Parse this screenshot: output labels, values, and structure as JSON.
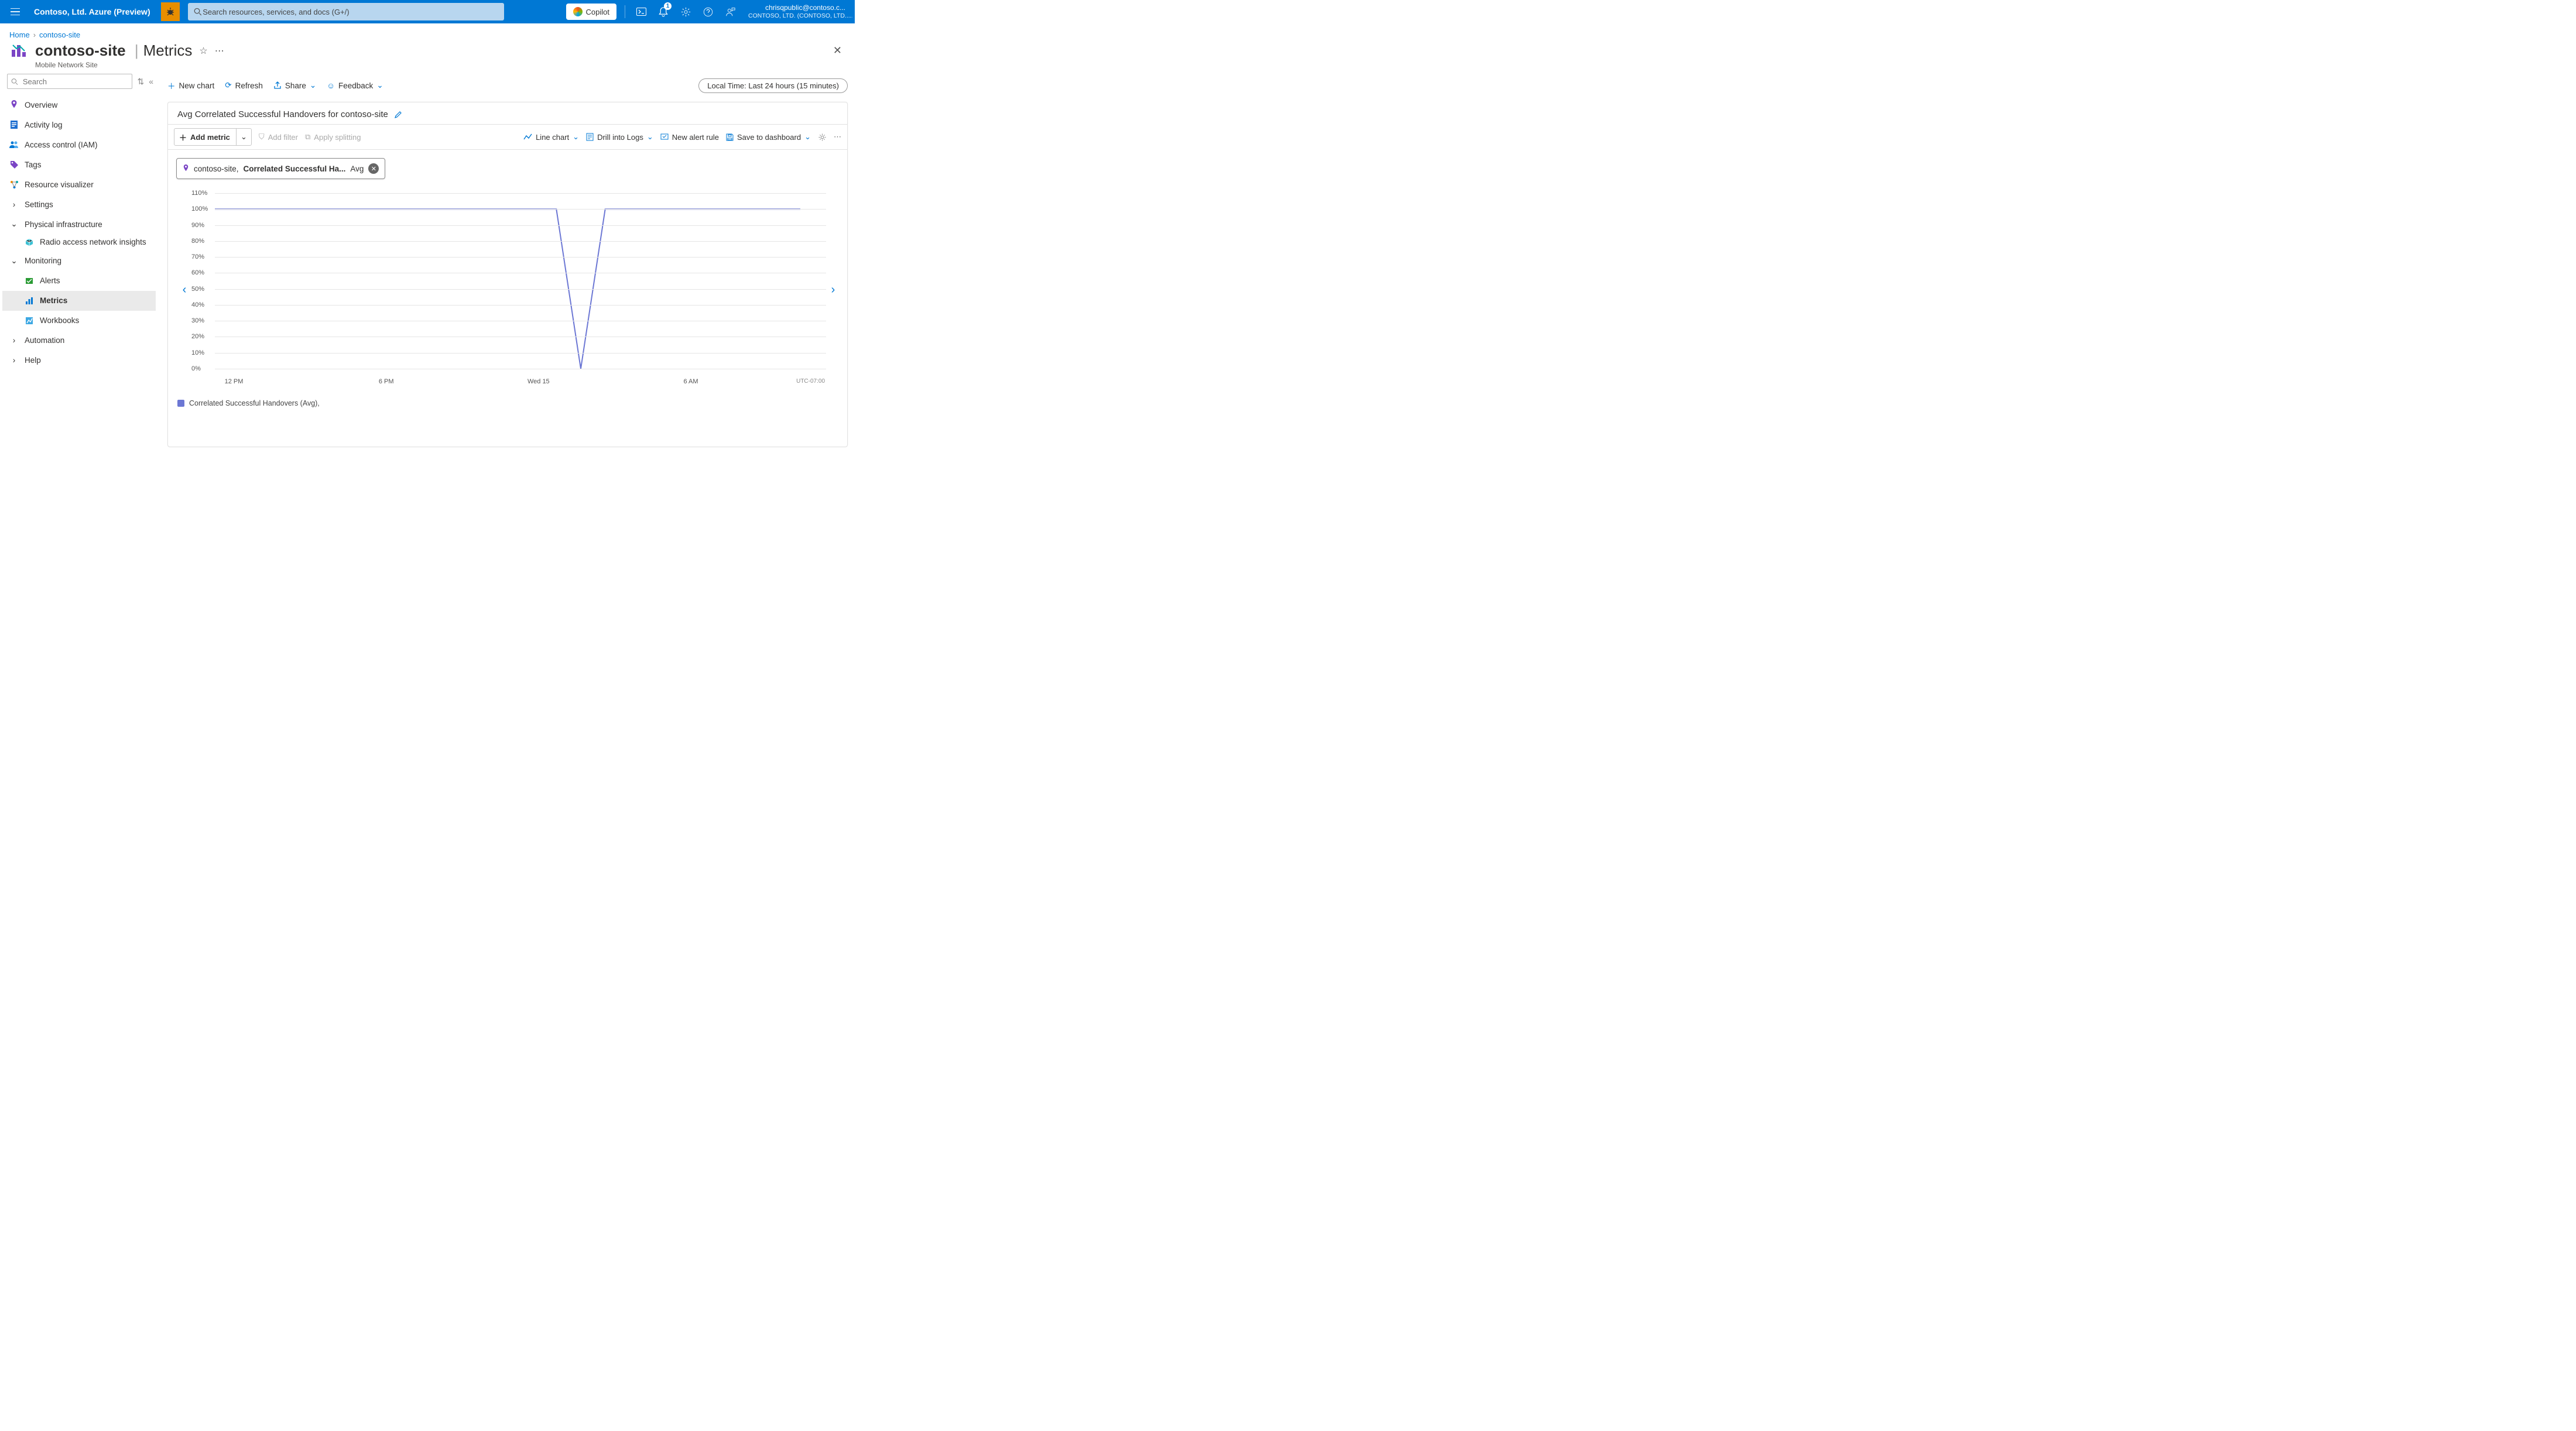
{
  "topbar": {
    "tenant": "Contoso, Ltd. Azure (Preview)",
    "search_placeholder": "Search resources, services, and docs (G+/)",
    "copilot": "Copilot",
    "notif_count": "1",
    "user_email": "chrisqpublic@contoso.c...",
    "user_org": "CONTOSO, LTD. (CONTOSO, LTD....."
  },
  "breadcrumb": {
    "home": "Home",
    "resource": "contoso-site"
  },
  "header": {
    "resource_name": "contoso-site",
    "section": "Metrics",
    "subtitle": "Mobile Network Site"
  },
  "sidebar": {
    "search_placeholder": "Search",
    "items": {
      "overview": "Overview",
      "activity": "Activity log",
      "iam": "Access control (IAM)",
      "tags": "Tags",
      "visualizer": "Resource visualizer",
      "settings": "Settings",
      "phys": "Physical infrastructure",
      "ran": "Radio access network insights",
      "monitoring": "Monitoring",
      "alerts": "Alerts",
      "metrics": "Metrics",
      "workbooks": "Workbooks",
      "automation": "Automation",
      "help": "Help"
    }
  },
  "cmdbar": {
    "new_chart": "New chart",
    "refresh": "Refresh",
    "share": "Share",
    "feedback": "Feedback",
    "time_pill": "Local Time: Last 24 hours (15 minutes)"
  },
  "chart": {
    "title": "Avg Correlated Successful Handovers for contoso-site",
    "add_metric": "Add metric",
    "add_filter": "Add filter",
    "apply_splitting": "Apply splitting",
    "line_chart": "Line chart",
    "drill_logs": "Drill into Logs",
    "new_alert": "New alert rule",
    "save_dash": "Save to dashboard",
    "pill_scope": "contoso-site,",
    "pill_metric": "Correlated Successful Ha...",
    "pill_agg": "Avg",
    "legend": "Correlated Successful Handovers (Avg),",
    "tz": "UTC-07:00"
  },
  "chart_data": {
    "type": "line",
    "title": "Avg Correlated Successful Handovers for contoso-site",
    "ylabel": "",
    "xlabel": "",
    "ylim": [
      0,
      110
    ],
    "y_ticks": [
      "0%",
      "10%",
      "20%",
      "30%",
      "40%",
      "50%",
      "60%",
      "70%",
      "80%",
      "90%",
      "100%",
      "110%"
    ],
    "x_ticks": [
      "12 PM",
      "6 PM",
      "Wed 15",
      "6 AM"
    ],
    "series": [
      {
        "name": "Correlated Successful Handovers (Avg)",
        "color": "#6c77d4",
        "x": [
          "12 PM",
          "1 PM",
          "2 PM",
          "3 PM",
          "4 PM",
          "5 PM",
          "6 PM",
          "7 PM",
          "8 PM",
          "9 PM",
          "10 PM",
          "11 PM",
          "Wed 15",
          "1 AM",
          "2 AM",
          "2:15 AM",
          "2:30 AM",
          "3 AM",
          "4 AM",
          "5 AM",
          "6 AM",
          "7 AM",
          "8 AM",
          "9 AM",
          "10 AM"
        ],
        "values": [
          100,
          100,
          100,
          100,
          100,
          100,
          100,
          100,
          100,
          100,
          100,
          100,
          100,
          100,
          100,
          0,
          100,
          100,
          100,
          100,
          100,
          100,
          100,
          100,
          100
        ]
      }
    ]
  }
}
